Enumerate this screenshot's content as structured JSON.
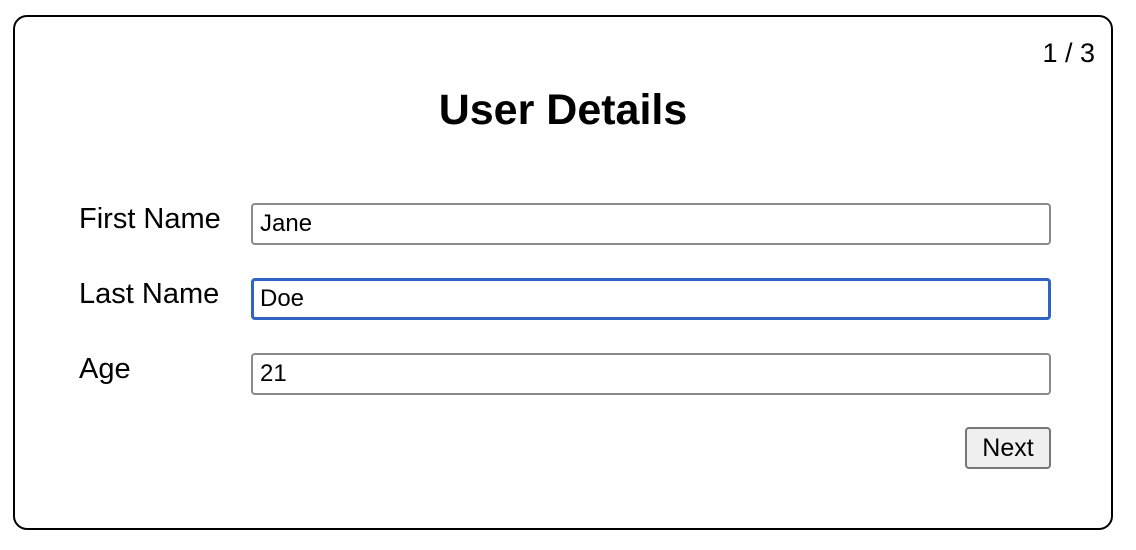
{
  "form": {
    "page_indicator": "1 / 3",
    "title": "User Details",
    "fields": [
      {
        "label": "First Name",
        "value": "Jane"
      },
      {
        "label": "Last Name",
        "value": "Doe"
      },
      {
        "label": "Age",
        "value": "21"
      }
    ],
    "next_label": "Next"
  },
  "colors": {
    "focus_border": "#2f63c4",
    "field_border": "#8a8a8a",
    "button_bg": "#efefef"
  }
}
